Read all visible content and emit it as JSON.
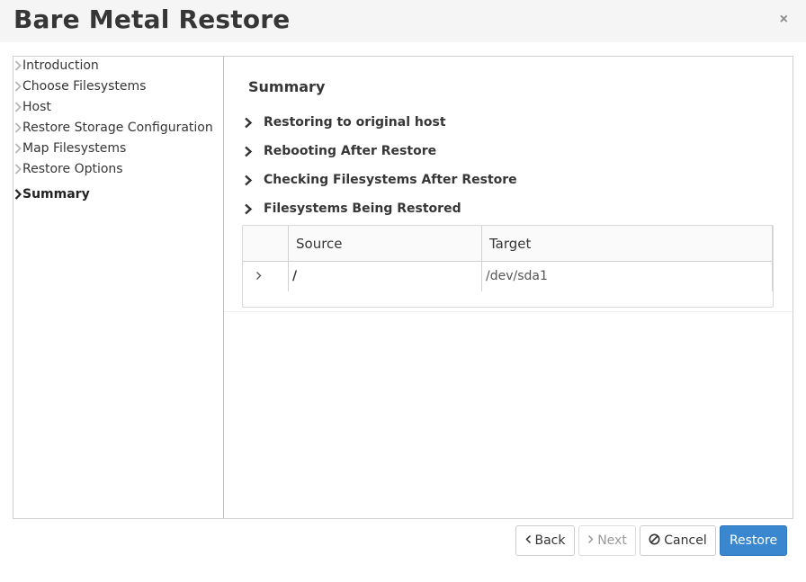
{
  "dialog": {
    "title": "Bare Metal Restore",
    "close_symbol": "×"
  },
  "sidebar": {
    "items": [
      {
        "label": "Introduction",
        "active": false
      },
      {
        "label": "Choose Filesystems",
        "active": false
      },
      {
        "label": "Host",
        "active": false
      },
      {
        "label": "Restore Storage Configuration",
        "active": false
      },
      {
        "label": "Map Filesystems",
        "active": false
      },
      {
        "label": "Restore Options",
        "active": false
      },
      {
        "label": "Summary",
        "active": true
      }
    ]
  },
  "main": {
    "title": "Summary",
    "sections": [
      {
        "label": "Restoring to original host"
      },
      {
        "label": "Rebooting After Restore"
      },
      {
        "label": "Checking Filesystems After Restore"
      },
      {
        "label": "Filesystems Being Restored"
      }
    ],
    "table": {
      "columns": [
        "Source",
        "Target"
      ],
      "rows": [
        {
          "source": "/",
          "target": "/dev/sda1"
        }
      ]
    }
  },
  "footer": {
    "back_label": "Back",
    "next_label": "Next",
    "cancel_label": "Cancel",
    "restore_label": "Restore"
  },
  "colors": {
    "primary": "#3a87cf",
    "header_bg": "#f5f5f5",
    "border": "#d1d1d1"
  }
}
